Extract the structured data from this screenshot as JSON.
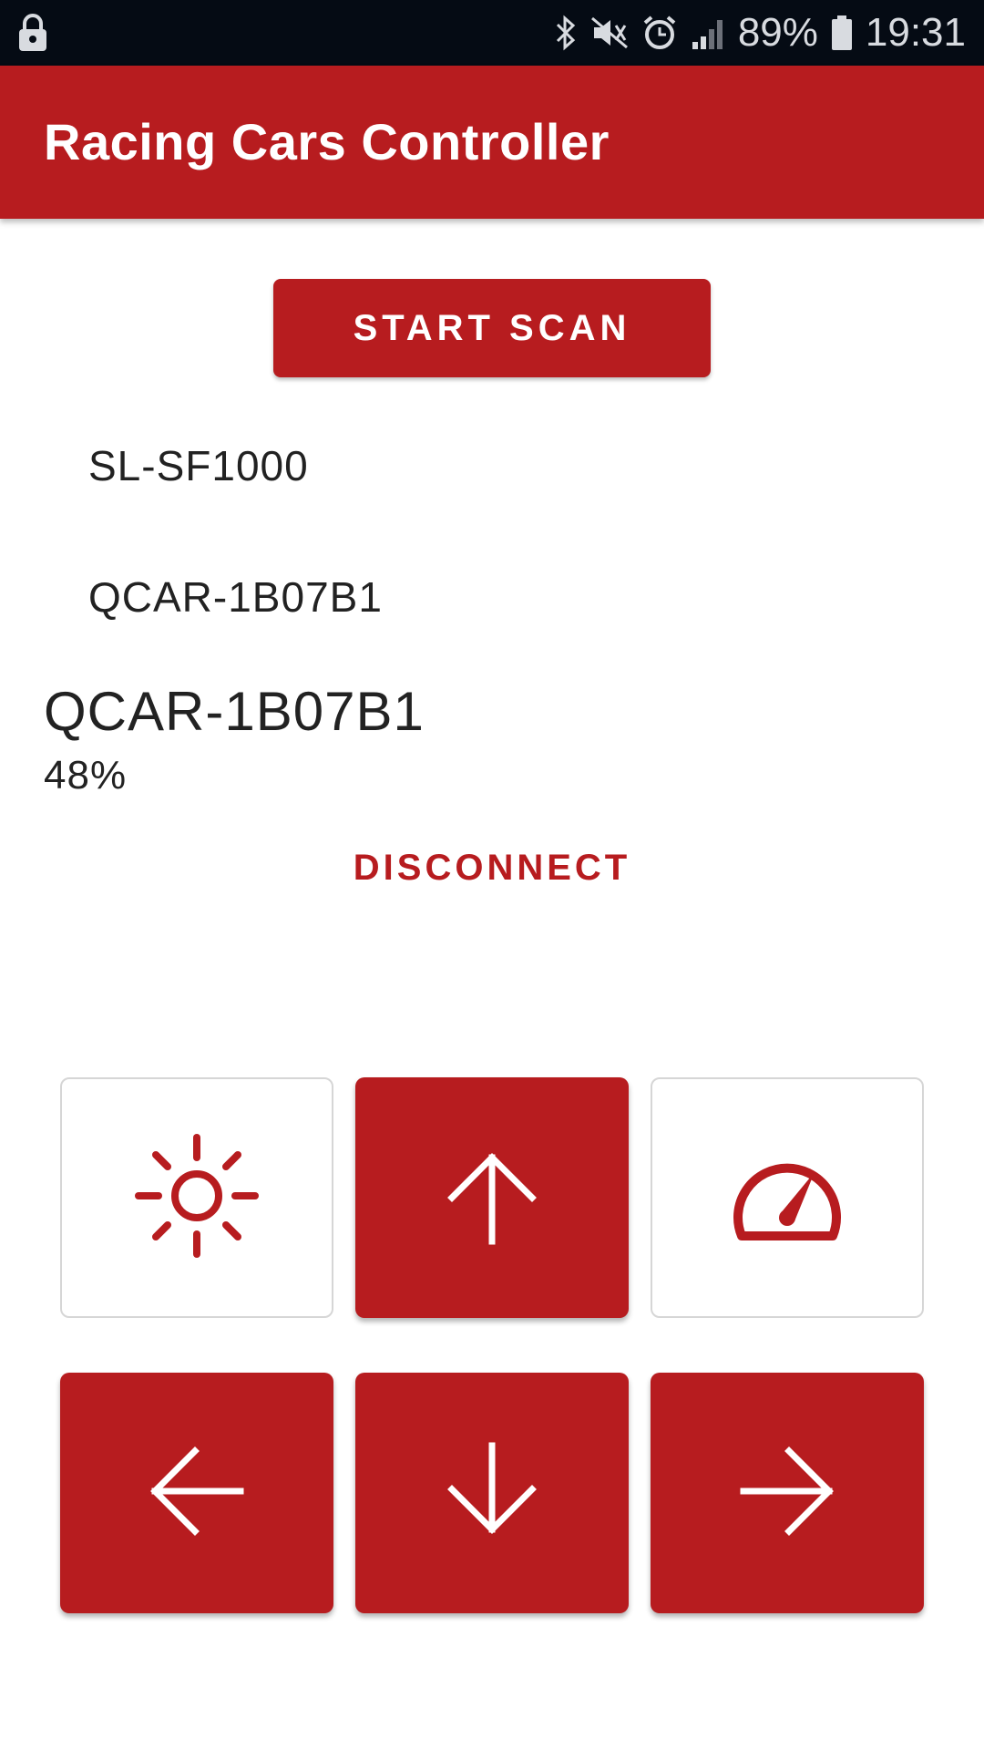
{
  "status_bar": {
    "battery_percent": "89%",
    "time": "19:31",
    "icons": [
      "lock-icon",
      "bluetooth-icon",
      "mute-icon",
      "alarm-icon",
      "signal-icon",
      "battery-icon"
    ]
  },
  "app_bar": {
    "title": "Racing Cars Controller"
  },
  "scan": {
    "label": "START SCAN"
  },
  "devices": [
    {
      "name": "SL-SF1000"
    },
    {
      "name": "QCAR-1B07B1"
    }
  ],
  "connected": {
    "name": "QCAR-1B07B1",
    "battery": "48%",
    "disconnect_label": "DISCONNECT"
  },
  "controls": {
    "icons": [
      "sun-icon",
      "arrow-up-icon",
      "speedometer-icon",
      "arrow-left-icon",
      "arrow-down-icon",
      "arrow-right-icon"
    ]
  },
  "colors": {
    "accent": "#b71c1f",
    "status_bar": "#050b14"
  }
}
